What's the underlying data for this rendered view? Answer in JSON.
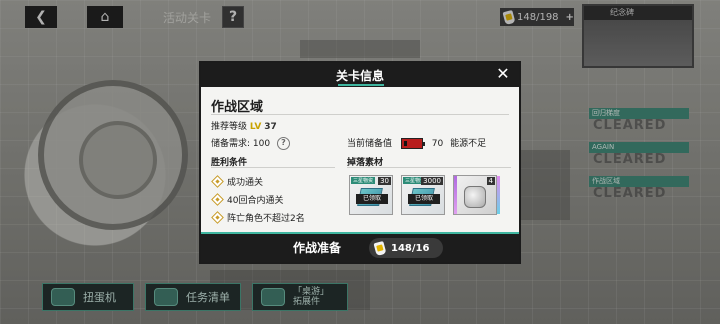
{
  "topbar": {
    "stage_label": "活动关卡",
    "help_glyph": "?",
    "stamina_text": "148/198",
    "stamina_plus": "+"
  },
  "side": {
    "thumb_caption": "纪念碑",
    "tags": [
      {
        "label": "回归梯度",
        "status": "CLEARED"
      },
      {
        "label": "AGAIN",
        "status": "CLEARED"
      },
      {
        "label": "作战区域",
        "status": "CLEARED"
      }
    ]
  },
  "bottom": {
    "gacha_label": "扭蛋机",
    "tasks_label": "任务清单",
    "expansion_line1": "「桌游」",
    "expansion_line2": "拓展件"
  },
  "dialog": {
    "title": "关卡信息",
    "close_glyph": "✕",
    "area_title": "作战区域",
    "recommended_label": "推荐等级",
    "recommended_prefix": "LV",
    "recommended_level": "37",
    "reserve_req_label": "储备需求: 100",
    "help_glyph": "?",
    "current_reserve_label": "当前储备值",
    "current_reserve_value": "70",
    "reserve_warning": "能源不足",
    "victory_title": "胜利条件",
    "conditions": [
      "成功通关",
      "40回合内通关",
      "阵亡角色不超过2名"
    ],
    "drops_title": "掉落素材",
    "drops": [
      {
        "tag": "三星物资",
        "qty": "30",
        "claimed": "已领取"
      },
      {
        "tag": "三星物资",
        "qty": "3000",
        "claimed": "已领取"
      },
      {
        "tag": "",
        "qty": "4",
        "claimed": ""
      }
    ],
    "prepare_label": "作战准备",
    "prepare_stamina": "148/16"
  },
  "colors": {
    "accent": "#3fb6a0",
    "level_gold": "#c9a300",
    "warning_red": "#b81d1d",
    "dark": "#1c1c1c"
  }
}
